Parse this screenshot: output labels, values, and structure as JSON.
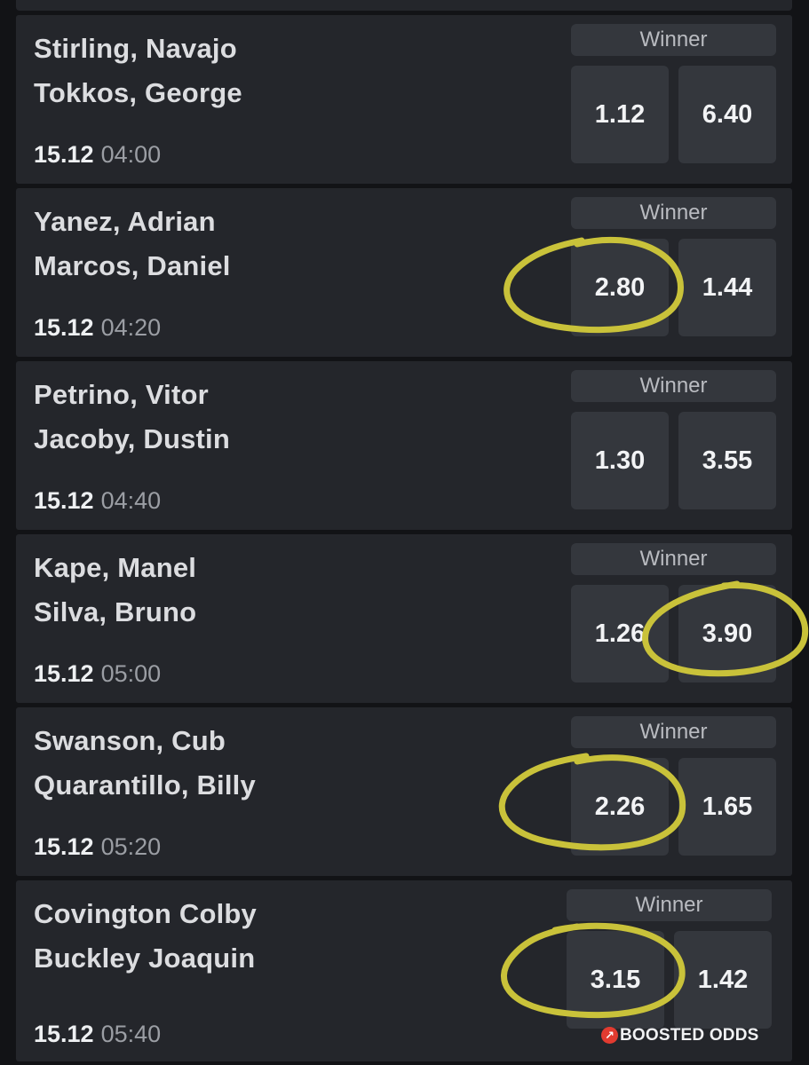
{
  "matches": [
    {
      "player1": "Stirling, Navajo",
      "player2": "Tokkos, George",
      "date": "15.12",
      "time": "04:00",
      "market": "Winner",
      "odds": [
        "1.12",
        "6.40"
      ]
    },
    {
      "player1": "Yanez, Adrian",
      "player2": "Marcos, Daniel",
      "date": "15.12",
      "time": "04:20",
      "market": "Winner",
      "odds": [
        "2.80",
        "1.44"
      ]
    },
    {
      "player1": "Petrino, Vitor",
      "player2": "Jacoby, Dustin",
      "date": "15.12",
      "time": "04:40",
      "market": "Winner",
      "odds": [
        "1.30",
        "3.55"
      ]
    },
    {
      "player1": "Kape, Manel",
      "player2": "Silva, Bruno",
      "date": "15.12",
      "time": "05:00",
      "market": "Winner",
      "odds": [
        "1.26",
        "3.90"
      ]
    },
    {
      "player1": "Swanson, Cub",
      "player2": "Quarantillo, Billy",
      "date": "15.12",
      "time": "05:20",
      "market": "Winner",
      "odds": [
        "2.26",
        "1.65"
      ]
    },
    {
      "player1": "Covington Colby",
      "player2": "Buckley Joaquin",
      "date": "15.12",
      "time": "05:40",
      "market": "Winner",
      "odds": [
        "3.15",
        "1.42"
      ],
      "badge": "BOOSTED ODDS"
    }
  ],
  "colors": {
    "page_background": "#121316",
    "card_background": "#24262b",
    "odds_button": "#34373d",
    "annotation_circle": "#c9c23a",
    "boost_icon": "#e23b30"
  },
  "icons": {
    "boost": "boosted-odds-icon"
  }
}
